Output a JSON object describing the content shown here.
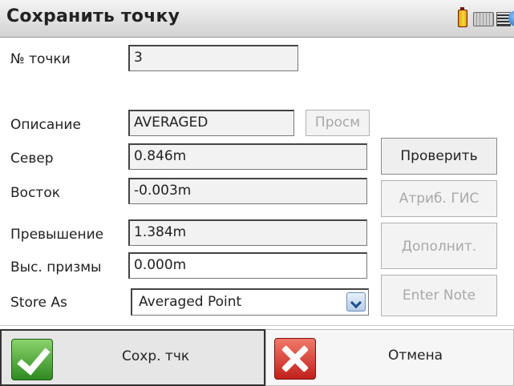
{
  "header": {
    "title": "Сохранить точку",
    "help_glyph": "?"
  },
  "form": {
    "point_number": {
      "label": "№ точки",
      "value": "3"
    },
    "description": {
      "label": "Описание",
      "value": "AVERAGED",
      "browse_label": "Просм"
    },
    "north": {
      "label": "Север",
      "value": "0.846m"
    },
    "east": {
      "label": "Восток",
      "value": "-0.003m"
    },
    "elevation": {
      "label": "Превышение",
      "value": "1.384m"
    },
    "prism_height": {
      "label": "Выс. призмы",
      "value": "0.000m"
    },
    "store_as": {
      "label": "Store As",
      "value": "Averaged Point"
    }
  },
  "side_buttons": {
    "check": "Проверить",
    "gis_attributes": "Атриб. ГИС",
    "additional": "Дополнит.",
    "enter_note": "Enter Note"
  },
  "bottom_buttons": {
    "save": "Сохр. тчк",
    "cancel": "Отмена"
  },
  "colors": {
    "save_icon": "#3a9a2a",
    "cancel_icon": "#d0281e",
    "disabled_text": "#a8a8a8"
  }
}
